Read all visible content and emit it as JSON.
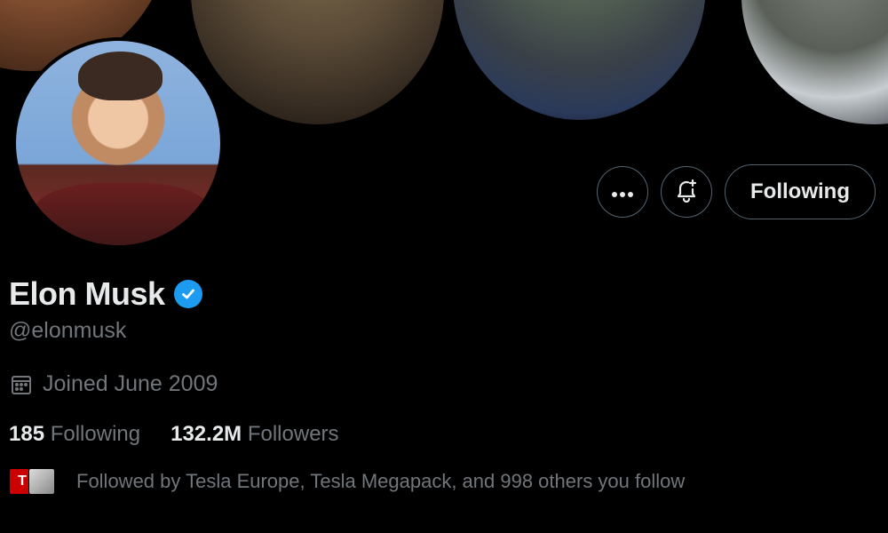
{
  "banner": {
    "alt": ""
  },
  "profile": {
    "name": "Elon Musk",
    "handle": "@elonmusk",
    "joined": "Joined June 2009",
    "verified": true,
    "following_count": "185",
    "following_label": "Following",
    "followers_count": "132.2M",
    "followers_label": "Followers",
    "followed_by": "Followed by Tesla Europe, Tesla Megapack, and 998 others you follow"
  },
  "actions": {
    "more_icon": "more-horizontal-icon",
    "notify_icon": "bell-plus-icon",
    "follow_state_label": "Following"
  },
  "colors": {
    "background": "#000000",
    "text": "#e7e9ea",
    "muted": "#71767b",
    "border": "#536471",
    "verified": "#1d9bf0",
    "tesla_red": "#cc0000"
  }
}
